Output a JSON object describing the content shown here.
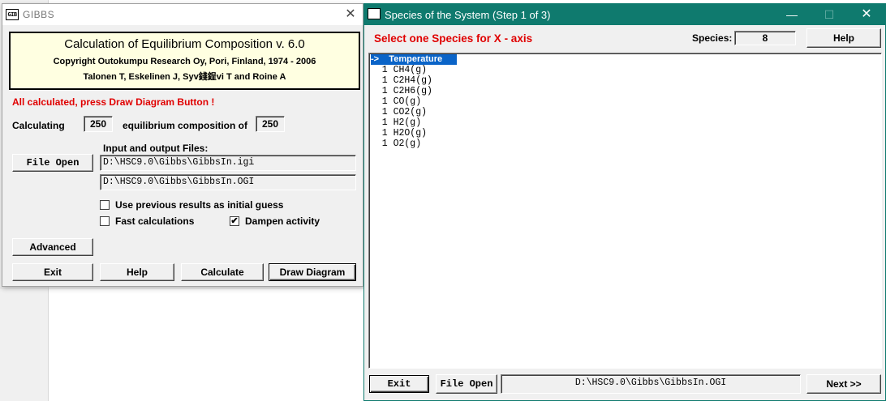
{
  "gibbs_window": {
    "icon_text": "GIB",
    "title": "GIBBS",
    "close_glyph": "✕",
    "info": {
      "title": "Calculation of Equilibrium Composition v. 6.0",
      "copyright": "Copyright Outokumpu Research Oy, Pori, Finland, 1974 - 2006",
      "authors": "Talonen T, Eskelinen J, Syv錢鋥vi T and Roine A"
    },
    "status_message": "All calculated, press Draw Diagram Button !",
    "calculating_label": "Calculating",
    "calculating_value": "250",
    "equilibrium_label": "equilibrium composition of",
    "equilibrium_value": "250",
    "io_label": "Input and output Files:",
    "file_open_label": "File Open",
    "input_path": "D:\\HSC9.0\\Gibbs\\GibbsIn.igi",
    "output_path": "D:\\HSC9.0\\Gibbs\\GibbsIn.OGI",
    "options": {
      "previous_results": {
        "label": "Use previous results as initial guess",
        "checked": false
      },
      "fast_calc": {
        "label": "Fast calculations",
        "checked": false
      },
      "dampen": {
        "label": "Dampen activity",
        "checked": true,
        "mark": "✔"
      }
    },
    "buttons": {
      "advanced": "Advanced",
      "exit": "Exit",
      "help": "Help",
      "calculate": "Calculate",
      "draw_diagram": "Draw Diagram"
    }
  },
  "species_window": {
    "icon_text": "PIC",
    "title": "Species of the System (Step 1 of 3)",
    "controls": {
      "minimize": "—",
      "maximize": "☐",
      "close": "✕"
    },
    "select_label": "Select one Species for X - axis",
    "species_label": "Species:",
    "species_count": "8",
    "help_label": "Help",
    "list_items": [
      {
        "text": "->    Temperature",
        "selected": true
      },
      {
        "text": "  1 CH4(g)",
        "selected": false
      },
      {
        "text": "  1 C2H4(g)",
        "selected": false
      },
      {
        "text": "  1 C2H6(g)",
        "selected": false
      },
      {
        "text": "  1 CO(g)",
        "selected": false
      },
      {
        "text": "  1 CO2(g)",
        "selected": false
      },
      {
        "text": "  1 H2(g)",
        "selected": false
      },
      {
        "text": "  1 H2O(g)",
        "selected": false
      },
      {
        "text": "  1 O2(g)",
        "selected": false
      }
    ],
    "exit_label": "Exit",
    "file_open_label": "File Open",
    "file_path": "D:\\HSC9.0\\Gibbs\\GibbsIn.OGI",
    "next_label": "Next >>"
  }
}
